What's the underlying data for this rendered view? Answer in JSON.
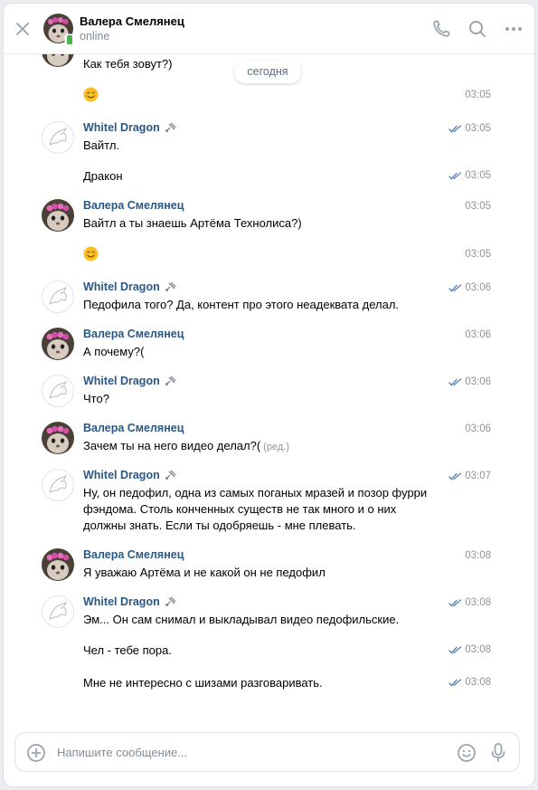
{
  "header": {
    "name": "Валера Смелянец",
    "status": "online",
    "close_icon": "close-icon",
    "call_icon": "phone-icon",
    "search_icon": "search-icon",
    "more_icon": "more-icon"
  },
  "date_separator": "сегодня",
  "colors": {
    "author_link": "#2a5885",
    "meta": "#939393",
    "read_check": "#5181b8",
    "online": "#4bb34b"
  },
  "messages": [
    {
      "author": "",
      "text": "Как тебя зовут?)",
      "time": ""
    },
    {
      "author": "",
      "text": "",
      "emoji": "smiling-face",
      "time": "03:05"
    },
    {
      "author": "Whitel Dragon",
      "text": "Вайтл.",
      "time": "03:05",
      "read": true
    },
    {
      "author": "",
      "text": "Дракон",
      "time": "03:05",
      "read": true
    },
    {
      "author": "Валера Смелянец",
      "text": "Вайтл а ты знаешь Артёма Технолиса?)",
      "time": "03:05"
    },
    {
      "author": "",
      "text": "",
      "emoji": "smiling-face",
      "time": "03:05"
    },
    {
      "author": "Whitel Dragon",
      "text": "Педофила того? Да, контент про этого неадеквата делал.",
      "time": "03:06",
      "read": true
    },
    {
      "author": "Валера Смелянец",
      "text": "А почему?(",
      "time": "03:06"
    },
    {
      "author": "Whitel Dragon",
      "text": "Что?",
      "time": "03:06",
      "read": true
    },
    {
      "author": "Валера Смелянец",
      "text": "Зачем ты на него видео делал?(",
      "edited": "(ред.)",
      "time": "03:06"
    },
    {
      "author": "Whitel Dragon",
      "text": "Ну, он педофил, одна из самых поганых мразей и позор фурри фэндома. Столь конченных существ не так много и о них должны знать. Если ты одобряешь - мне плевать.",
      "time": "03:07",
      "read": true
    },
    {
      "author": "Валера Смелянец",
      "text": "Я уважаю Артёма и не какой он не педофил",
      "time": "03:08"
    },
    {
      "author": "Whitel Dragon",
      "text": "Эм... Он сам снимал и выкладывал видео педофильские.",
      "time": "03:08",
      "read": true
    },
    {
      "author": "",
      "text": "Чел - тебе пора.",
      "time": "03:08",
      "read": true
    },
    {
      "author": "",
      "text": "Мне не интересно с шизами разговаривать.",
      "time": "03:08",
      "read": true
    }
  ],
  "composer": {
    "placeholder": "Напишите сообщение...",
    "attach_icon": "add-circle-icon",
    "emoji_icon": "smile-icon",
    "mic_icon": "microphone-icon"
  }
}
